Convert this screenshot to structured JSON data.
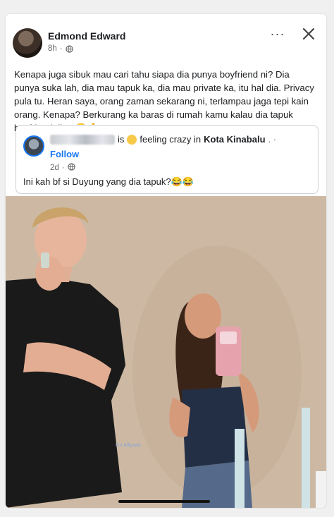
{
  "post": {
    "author": "Edmond Edward",
    "time": "8h",
    "dot": "·",
    "more_label": "···",
    "text": "Kenapa juga sibuk mau cari tahu siapa dia punya boyfriend ni? Dia punya suka lah, dia mau tapuk ka, dia mau private ka, itu hal dia. Privacy pula tu. Heran saya, orang zaman sekarang ni, terlampau jaga tepi kain orang. Kenapa? Berkurang ka baras di rumah kamu kalau dia tapuk boyfriend dia? 😏🤞"
  },
  "shared": {
    "is_suffix": "is",
    "feeling": "feeling crazy in",
    "location": "Kota Kinabalu",
    "trailing": ".  ·",
    "follow": "Follow",
    "time": "2d",
    "dot": "·",
    "text": "Ini kah bf si Duyung yang dia tapuk?😂😂"
  },
  "photo": {
    "watermark": "tlor  Alliyaaa"
  },
  "colors": {
    "accent": "#1877f2",
    "secondary_text": "#65676b",
    "story_background": "#f0f0f0",
    "photo_wall": "#cbb6a0"
  },
  "icons": {
    "globe": "globe-icon",
    "close": "close-icon",
    "more": "more-options-icon"
  }
}
